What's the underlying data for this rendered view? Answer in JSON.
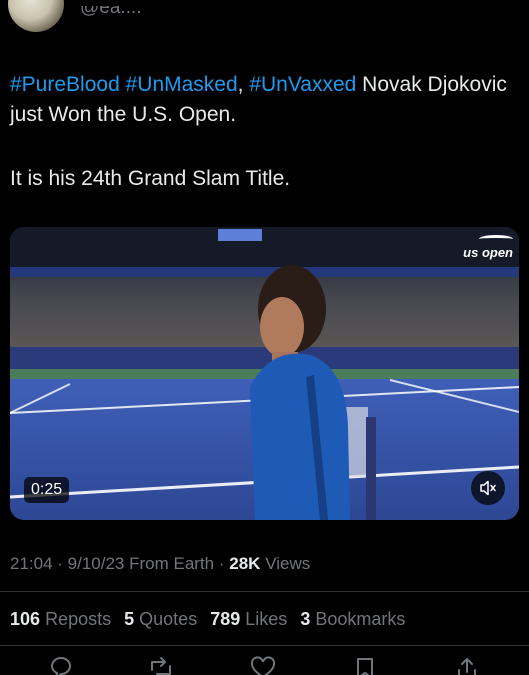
{
  "author": {
    "handle": "@ea...."
  },
  "tweet": {
    "hashtags": [
      "#PureBlood",
      "#UnMasked",
      "#UnVaxxed"
    ],
    "separator_1": " ",
    "separator_2": ", ",
    "text_after_tags": " Novak Djokovic just  Won the U.S. Open.",
    "line2": "It is his 24th Grand Slam Title."
  },
  "media": {
    "type": "video",
    "duration": "0:25",
    "brand": "us open",
    "mute_icon": "speaker-muted-icon"
  },
  "meta": {
    "time": "21:04",
    "date": "9/10/23",
    "source": "From Earth",
    "views_count": "28K",
    "views_label": "Views",
    "dot": " · "
  },
  "stats": [
    {
      "count": "106",
      "label": "Reposts"
    },
    {
      "count": "5",
      "label": "Quotes"
    },
    {
      "count": "789",
      "label": "Likes"
    },
    {
      "count": "3",
      "label": "Bookmarks"
    }
  ],
  "actions": [
    "reply-icon",
    "repost-icon",
    "like-icon",
    "bookmark-icon",
    "share-icon"
  ],
  "colors": {
    "link": "#1d9bf0",
    "text": "#e7e9ea",
    "muted": "#71767b",
    "background": "#000000",
    "divider": "#2f3336"
  }
}
